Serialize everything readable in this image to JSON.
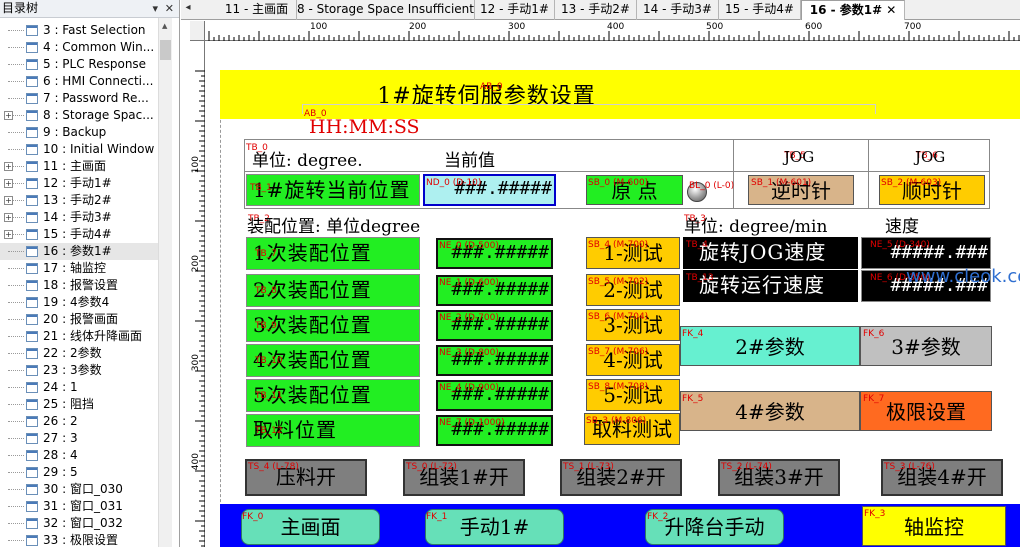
{
  "tree": {
    "header": "目录树",
    "items": [
      {
        "label": "3 : Fast Selection",
        "expander": ""
      },
      {
        "label": "4 : Common Win...",
        "expander": ""
      },
      {
        "label": "5 : PLC Response",
        "expander": ""
      },
      {
        "label": "6 : HMI Connecti...",
        "expander": ""
      },
      {
        "label": "7 : Password Re...",
        "expander": ""
      },
      {
        "label": "8 : Storage Spac...",
        "expander": "+"
      },
      {
        "label": "9 : Backup",
        "expander": ""
      },
      {
        "label": "10 : Initial Window",
        "expander": ""
      },
      {
        "label": "11 : 主画面",
        "expander": "+"
      },
      {
        "label": "12 : 手动1#",
        "expander": "+"
      },
      {
        "label": "13 : 手动2#",
        "expander": "+"
      },
      {
        "label": "14 : 手动3#",
        "expander": "+"
      },
      {
        "label": "15 : 手动4#",
        "expander": "+"
      },
      {
        "label": "16 : 参数1#",
        "expander": ""
      },
      {
        "label": "17 : 轴监控",
        "expander": ""
      },
      {
        "label": "18 : 报警设置",
        "expander": ""
      },
      {
        "label": "19 : 4参数4",
        "expander": ""
      },
      {
        "label": "20 : 报警画面",
        "expander": ""
      },
      {
        "label": "21 : 线体升降画面",
        "expander": ""
      },
      {
        "label": "22 : 2参数",
        "expander": ""
      },
      {
        "label": "23 : 3参数",
        "expander": ""
      },
      {
        "label": "24 : 1",
        "expander": ""
      },
      {
        "label": "25 : 阻挡",
        "expander": ""
      },
      {
        "label": "26 : 2",
        "expander": ""
      },
      {
        "label": "27 : 3",
        "expander": ""
      },
      {
        "label": "28 : 4",
        "expander": ""
      },
      {
        "label": "29 : 5",
        "expander": ""
      },
      {
        "label": "30 : 窗口_030",
        "expander": ""
      },
      {
        "label": "31 : 窗口_031",
        "expander": ""
      },
      {
        "label": "32 : 窗口_032",
        "expander": ""
      },
      {
        "label": "33 : 极限设置",
        "expander": ""
      }
    ],
    "selected_index": 13
  },
  "tabs": [
    {
      "label": "11 - 主画面"
    },
    {
      "label": "8 - Storage Space Insufficient"
    },
    {
      "label": "12 - 手动1#"
    },
    {
      "label": "13 - 手动2#"
    },
    {
      "label": "14 - 手动3#"
    },
    {
      "label": "15 - 手动4#"
    },
    {
      "label": "16 - 参数1#",
      "close": "✕"
    }
  ],
  "ruler": {
    "top": [
      "100",
      "200",
      "300",
      "400",
      "500",
      "600",
      "700"
    ],
    "left": [
      "100",
      "200",
      "300",
      "400"
    ]
  },
  "screen": {
    "title": "1#旋转伺服参数设置",
    "title_tag": "AB_0",
    "clock_tag": "AB_0",
    "clock": "HH:MM:SS",
    "unit_tag": "TB_0",
    "unit_label": "单位: degree.",
    "current_value_label": "当前值",
    "jog_label_1": "JOG",
    "jog_label_2": "JOG",
    "jog_tag_1": "TB_5",
    "jog_tag_2": "TB_6",
    "cur_pos_tag": "TB_1",
    "cur_pos_label": "1#旋转当前位置",
    "cur_pos_num_tag": "ND_0 (D-10)",
    "cur_pos_value": "###.#####",
    "origin_tag": "SB_0 (M-600)",
    "origin_label": "原  点",
    "lamp_tag": "BL_0 (L-0)",
    "ccw_tag": "SB_1 (M-601)",
    "ccw_label": "逆时针",
    "cw_tag": "SB_2 (M-603)",
    "cw_label": "顺时针",
    "assembly_header": "装配位置: 单位degree",
    "assembly_tag": "TB_2",
    "speed_unit_tag": "TB_3",
    "speed_unit": "单位: degree/min",
    "speed_label": "速度",
    "rows": [
      {
        "label": "1次装配位置",
        "tag": "TB_7",
        "num_tag": "NE_0 (D-500)",
        "value": "###.#####",
        "btn_tag": "SB_4 (M-700)",
        "btn": "1-测试"
      },
      {
        "label": "2次装配位置",
        "tag": "TB_8",
        "num_tag": "NE_1 (D-600)",
        "value": "###.#####",
        "btn_tag": "SB_5 (M-702)",
        "btn": "2-测试"
      },
      {
        "label": "3次装配位置",
        "tag": "TB_9",
        "num_tag": "NE_2 (D-700)",
        "value": "###.#####",
        "btn_tag": "SB_6 (M-704)",
        "btn": "3-测试"
      },
      {
        "label": "4次装配位置",
        "tag": "TB_10",
        "num_tag": "NE_3 (D-800)",
        "value": "###.#####",
        "btn_tag": "SB_7 (M-706)",
        "btn": "4-测试"
      },
      {
        "label": "5次装配位置",
        "tag": "TB_11",
        "num_tag": "NE_4 (D-900)",
        "value": "###.#####",
        "btn_tag": "SB_8 (M-708)",
        "btn": "5-测试"
      },
      {
        "label": "取料位置",
        "tag": "TB_12",
        "num_tag": "NE_7 (D-1000)",
        "value": "###.#####",
        "btn_tag": "SB_3 (M-806)",
        "btn": "取料测试"
      }
    ],
    "jog_speed_tag": "TB_4",
    "jog_speed_label": "旋转JOG速度",
    "jog_speed_num_tag": "NE_5 (D-340)",
    "jog_speed_value": "#####.###",
    "run_speed_tag": "TB_13",
    "run_speed_label": "旋转运行速度",
    "run_speed_num_tag": "NE_6 (D-350)",
    "run_speed_value": "#####.###",
    "param2_tag": "FK_4",
    "param2": "2#参数",
    "param3_tag": "FK_6",
    "param3": "3#参数",
    "param4_tag": "FK_5",
    "param4": "4#参数",
    "limit_tag": "FK_7",
    "limit": "极限设置",
    "toggles": [
      {
        "tag": "TS_4 (L-78)",
        "label": "压料开"
      },
      {
        "tag": "TS_0 (L-72)",
        "label": "组装1#开"
      },
      {
        "tag": "TS_1 (L-73)",
        "label": "组装2#开"
      },
      {
        "tag": "TS_2 (L-74)",
        "label": "组装3#开"
      },
      {
        "tag": "TS_3 (L-76)",
        "label": "组装4#开"
      }
    ],
    "nav": [
      {
        "tag": "FK_0",
        "label": "主画面"
      },
      {
        "tag": "FK_1",
        "label": "手动1#"
      },
      {
        "tag": "FK_2",
        "label": "升降台手动"
      },
      {
        "tag": "FK_3",
        "label": "轴监控"
      }
    ],
    "watermark": "www.cleok.com"
  },
  "colors": {
    "title": "#ffff00",
    "green": "#22ee22",
    "yellow": "#ffcc00",
    "tan": "#d8b48a",
    "teal": "#66f0d0",
    "orange": "#ff6a20",
    "gray": "#7f7f7f",
    "blue": "#0000ff",
    "tag": "#e00000"
  }
}
